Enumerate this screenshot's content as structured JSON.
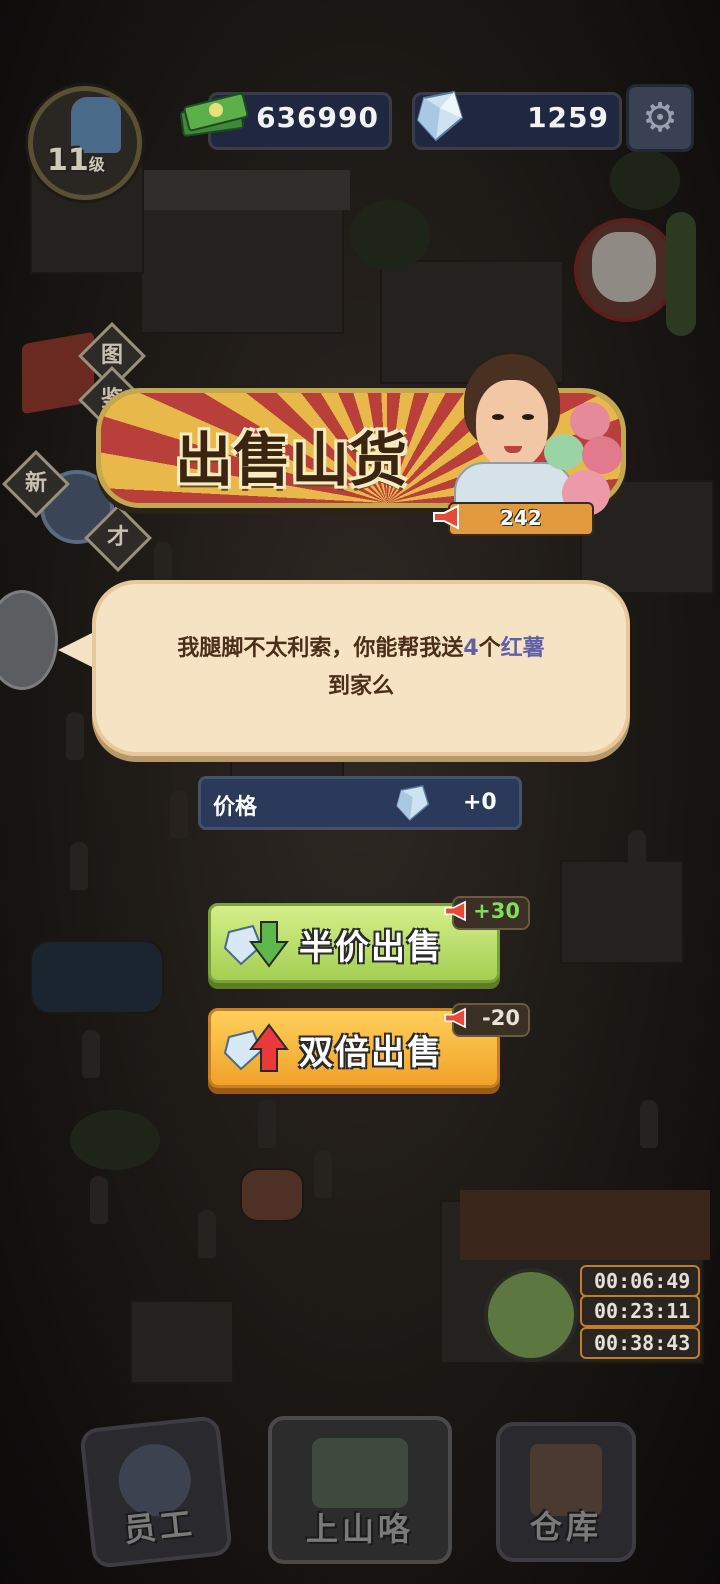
{
  "player": {
    "level": "11",
    "level_unit": "级",
    "money": "636990",
    "gems": "1259"
  },
  "side_menu": {
    "book_tag_top": "图",
    "book_tag_bottom": "鉴",
    "talent_tag_top": "新",
    "talent_tag_bottom": "才"
  },
  "dialog": {
    "title": "出售山货",
    "fame": "242",
    "message_part1": "我腿脚不太利索，你能帮我送",
    "quantity": "4",
    "quantity_unit": "个",
    "item_name": "红薯",
    "message_part2": "到家么",
    "price_label": "价格",
    "price_value": "+0",
    "half_price_button": "半价出售",
    "half_price_fame": "+30",
    "double_price_button": "双倍出售",
    "double_price_fame": "-20"
  },
  "timers": [
    "00:06:49",
    "00:23:11",
    "00:38:43"
  ],
  "bottom_nav": {
    "staff": "员工",
    "mountain": "上山咯",
    "warehouse": "仓库"
  },
  "colors": {
    "half_fame": "#7ee05a",
    "highlight": "#6060a8",
    "banner_red": "#b9403a",
    "banner_gold": "#e8b84a"
  },
  "icons": [
    "thumbs-up-icon",
    "money-stack-icon",
    "diamond-icon",
    "gear-icon",
    "megaphone-icon",
    "arrow-down-icon",
    "arrow-up-icon"
  ]
}
